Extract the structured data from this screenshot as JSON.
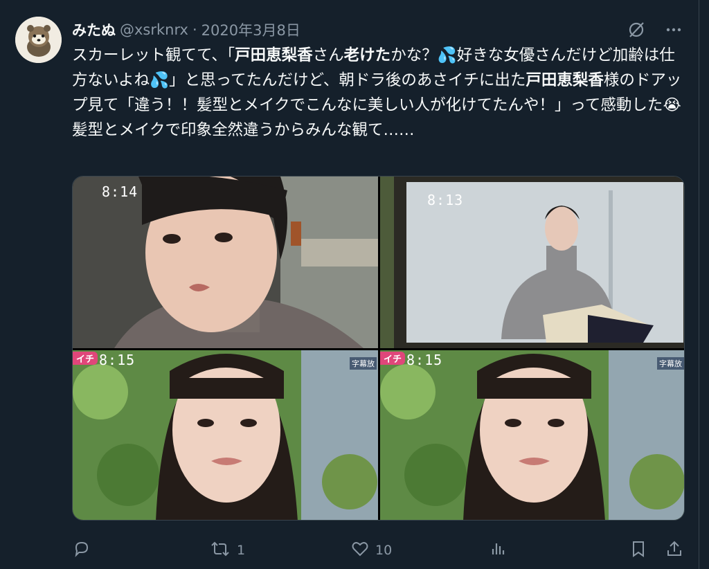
{
  "author": {
    "name": "みたぬ",
    "handle": "@xsrknrx",
    "separator": "·",
    "date": "2020年3月8日"
  },
  "tweet": {
    "text_1": "スカーレット観てて、「",
    "bold_1": "戸田恵梨香",
    "text_2": "さん",
    "bold_2": "老けた",
    "text_3": "かな？💦好きな女優さんだけど加齢は仕方ないよね💦」と思ってたんだけど、朝ドラ後のあさイチに出た",
    "bold_3": "戸田恵梨香",
    "text_4": "様のドアップ見て「違う！！髪型とメイクでこんなに美しい人が化けてたんや！」って感動した😭　髪型とメイクで印象全然違うからみんな観て……"
  },
  "media": {
    "tiles": [
      {
        "clock": "8:14"
      },
      {
        "clock": "8:13"
      },
      {
        "clock": "8:15",
        "badge": "イチ",
        "caption": "字幕放"
      },
      {
        "clock": "8:15",
        "badge": "イチ",
        "caption": "字幕放"
      }
    ]
  },
  "actions": {
    "reply_count": "",
    "retweet_count": "1",
    "like_count": "10"
  },
  "icons": {
    "grok": "grok-icon",
    "more": "more-icon",
    "reply": "reply-icon",
    "retweet": "retweet-icon",
    "like": "heart-icon",
    "views": "views-icon",
    "bookmark": "bookmark-icon",
    "share": "share-icon"
  },
  "colors": {
    "background": "#15202b",
    "text": "#f7f9f9",
    "muted": "#8b98a5",
    "badge": "#e0467a"
  }
}
